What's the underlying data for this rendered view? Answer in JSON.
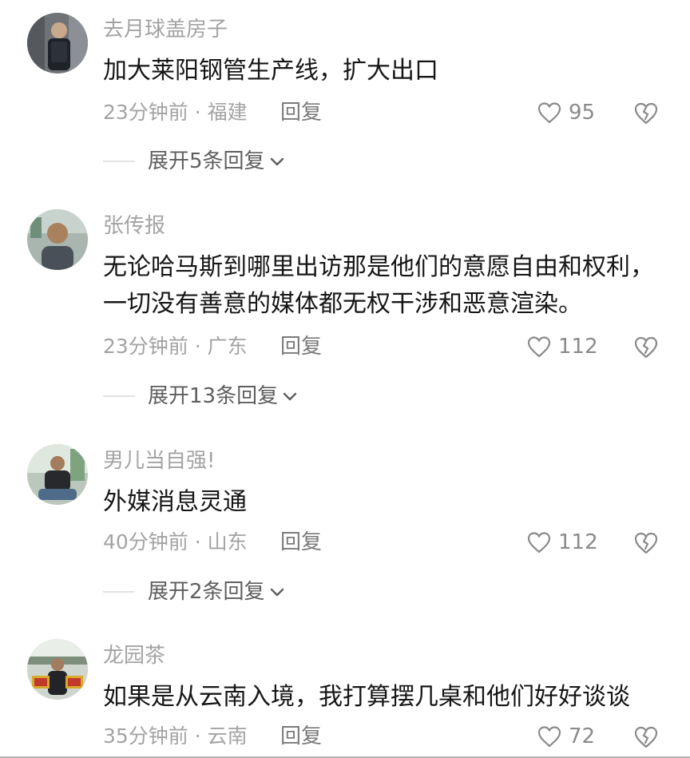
{
  "comments": [
    {
      "username": "去月球盖房子",
      "text": "加大莱阳钢管生产线，扩大出口",
      "meta": "23分钟前 · 福建",
      "reply_label": "回复",
      "likes": "95",
      "expand_label": "展开5条回复"
    },
    {
      "username": "张传报",
      "text": "无论哈马斯到哪里出访那是他们的意愿自由和权利，一切没有善意的媒体都无权干涉和恶意渲染。",
      "meta": "23分钟前 · 广东",
      "reply_label": "回复",
      "likes": "112",
      "expand_label": "展开13条回复"
    },
    {
      "username": "男儿当自强!",
      "text": "外媒消息灵通",
      "meta": "40分钟前 · 山东",
      "reply_label": "回复",
      "likes": "112",
      "expand_label": "展开2条回复"
    },
    {
      "username": "龙园茶",
      "text": "如果是从云南入境，我打算摆几桌和他们好好谈谈",
      "meta": "35分钟前 · 云南",
      "reply_label": "回复",
      "likes": "72"
    }
  ],
  "icons": {
    "like": "heart-outline-icon",
    "dislike": "broken-heart-icon",
    "expand": "chevron-down-icon"
  },
  "colors": {
    "text": "#161616",
    "muted": "#a3a3a3",
    "icon": "#8a8a8a"
  }
}
